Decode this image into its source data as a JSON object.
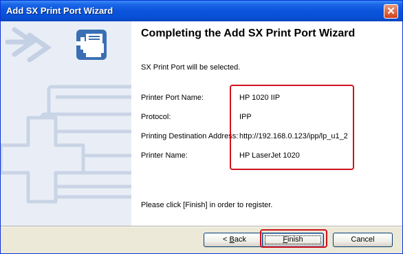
{
  "window": {
    "title": "Add SX Print Port Wizard",
    "close_icon_glyph": "✕"
  },
  "wizard": {
    "heading": "Completing the Add SX Print Port Wizard",
    "selected_text": "SX Print Port will be selected.",
    "fields": [
      {
        "label": "Printer Port Name:",
        "value": "HP 1020 IIP"
      },
      {
        "label": "Protocol:",
        "value": "IPP"
      },
      {
        "label": "Printing Destination Address:",
        "value": "http://192.168.0.123/ipp/lp_u1_2"
      },
      {
        "label": "Printer Name:",
        "value": "HP LaserJet 1020"
      }
    ],
    "footer_note": "Please click [Finish] in order to register."
  },
  "buttons": {
    "back_prefix": "< ",
    "back_mnemonic": "B",
    "back_rest": "ack",
    "finish_mnemonic": "F",
    "finish_rest": "inish",
    "cancel": "Cancel"
  },
  "colors": {
    "title_bar": "#0a54dc",
    "highlight": "#d0101c",
    "panel": "#e9eef6",
    "icon_blue": "#3a6fb4"
  }
}
